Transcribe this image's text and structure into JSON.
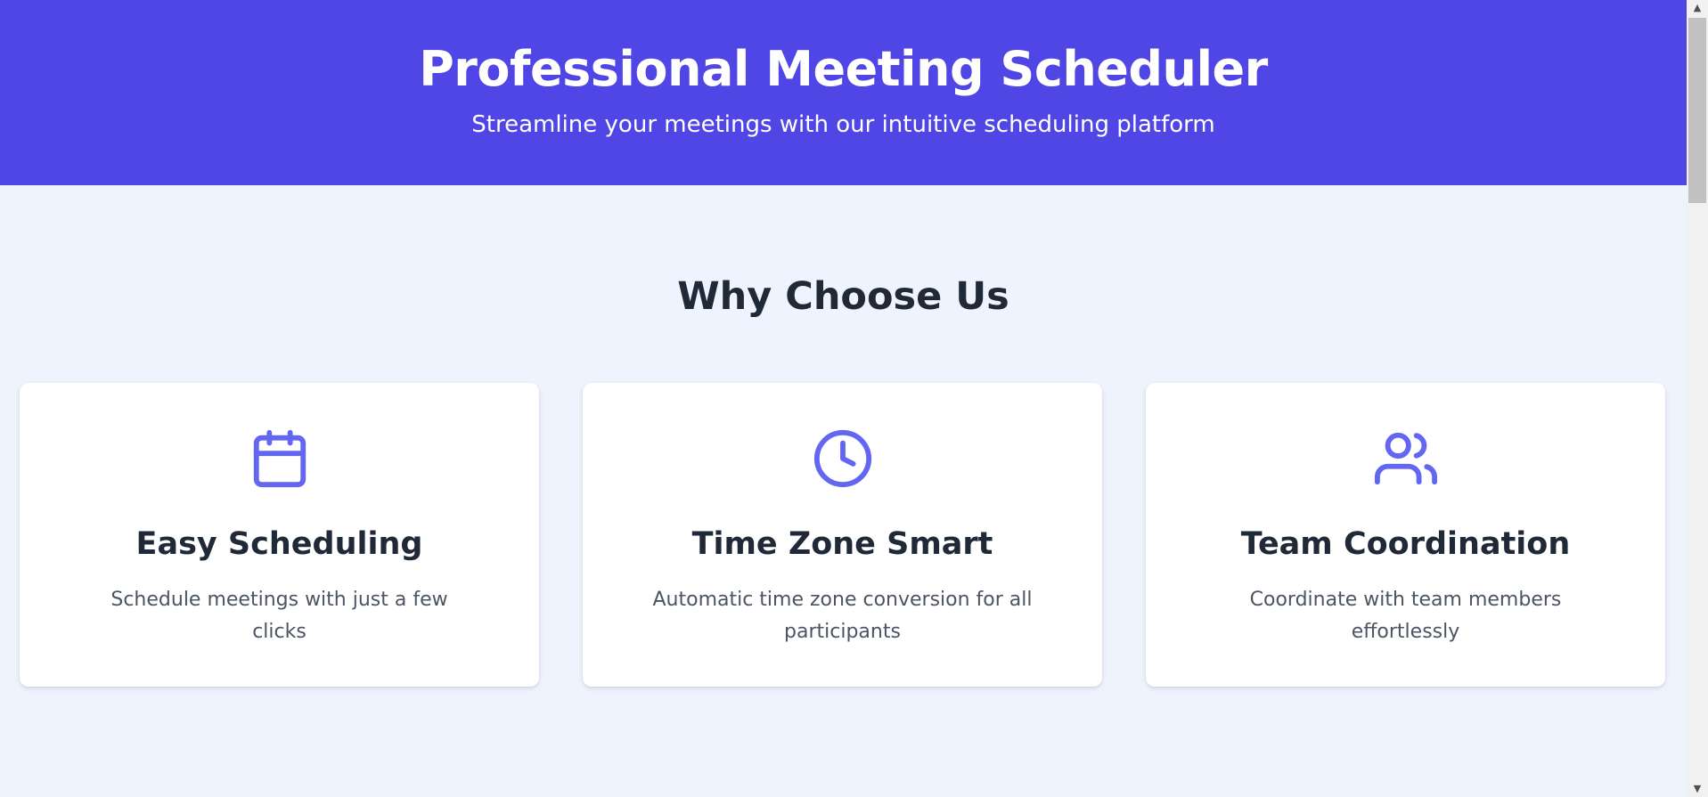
{
  "hero": {
    "title": "Professional Meeting Scheduler",
    "subtitle": "Streamline your meetings with our intuitive scheduling platform",
    "background_color": "#4f46e5"
  },
  "features": {
    "heading": "Why Choose Us",
    "accent_color": "#6366f1",
    "cards": [
      {
        "icon": "calendar-icon",
        "title": "Easy Scheduling",
        "description": "Schedule meetings with just a few clicks"
      },
      {
        "icon": "clock-icon",
        "title": "Time Zone Smart",
        "description": "Automatic time zone conversion for all participants"
      },
      {
        "icon": "users-icon",
        "title": "Team Coordination",
        "description": "Coordinate with team members effortlessly"
      }
    ]
  },
  "scrollbar": {
    "up_arrow": "▲",
    "down_arrow": "▼"
  }
}
